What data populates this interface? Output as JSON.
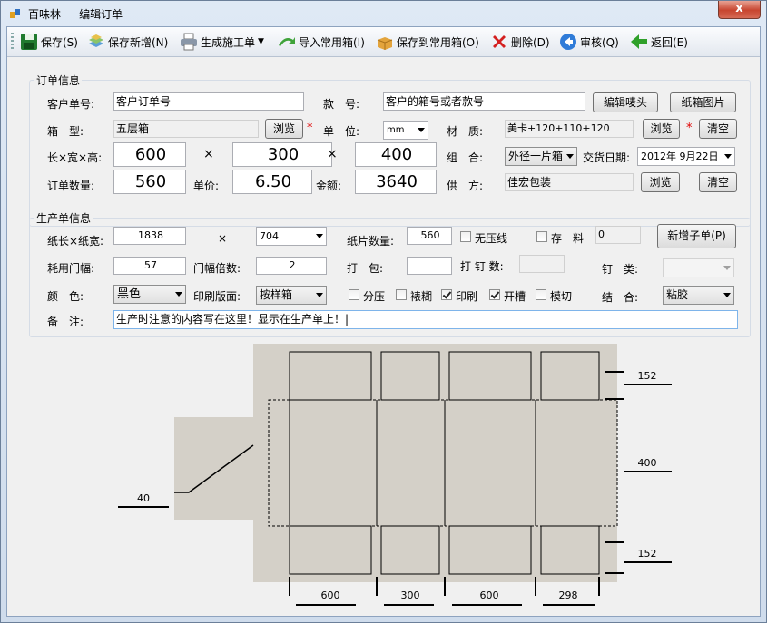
{
  "window": {
    "title": "百味林 - - 编辑订单",
    "close_glyph": "x"
  },
  "toolbar": {
    "save": "保存(S)",
    "save_new": "保存新增(N)",
    "generate_work_order": "生成施工单",
    "import_common_box": "导入常用箱(I)",
    "save_to_common_box": "保存到常用箱(O)",
    "delete": "删除(D)",
    "review": "审核(Q)",
    "back": "返回(E)"
  },
  "order_info": {
    "group_title": "订单信息",
    "customer_order_no_label": "客户单号:",
    "customer_order_no": "客户订单号",
    "style_no_label": "款　号:",
    "style_no": "客户的箱号或者款号",
    "edit_mark_button": "编辑唛头",
    "box_image_button": "纸箱图片",
    "box_type_label": "箱　型:",
    "box_type": "五层箱",
    "browse_label": "浏览",
    "unit_label": "单　位:",
    "unit": "mm",
    "material_label": "材　质:",
    "material": "美卡+120+110+120",
    "clear_label": "清空",
    "lwh_label": "长×宽×高:",
    "length": "600",
    "width": "300",
    "height": "400",
    "times1": "×",
    "times2": "×",
    "combine_label": "组　合:",
    "combine": "外径一片箱",
    "delivery_date_label": "交货日期:",
    "delivery_date": "2012年 9月22日",
    "quantity_label": "订单数量:",
    "quantity": "560",
    "price_label": "单价:",
    "price": "6.50",
    "amount_label": "金额:",
    "amount": "3640",
    "supplier_label": "供　方:",
    "supplier": "佳宏包装",
    "required_mark": "*"
  },
  "production_info": {
    "group_title": "生产单信息",
    "sheet_lw_label": "纸长×纸宽:",
    "sheet_length": "1838",
    "sheet_times": "×",
    "sheet_width": "704",
    "sheet_count_label": "纸片数量:",
    "sheet_count": "560",
    "no_press_line_label": "无压线",
    "stock_label": "存　料",
    "stock_value": "0",
    "add_sub_order_button": "新增子单(P)",
    "material_width_label": "耗用门幅:",
    "material_width": "57",
    "width_multiple_label": "门幅倍数:",
    "width_multiple": "2",
    "pack_label": "打　包:",
    "pack_value": "",
    "staple_count_label": "打 钉 数:",
    "staple_type_label": "钉　类:",
    "color_label": "颜　色:",
    "color": "黑色",
    "print_plate_label": "印刷版面:",
    "print_plate": "按样箱",
    "fenya_label": "分压",
    "biaohu_label": "裱糊",
    "print_label": "印刷",
    "slot_label": "开槽",
    "die_cut_label": "模切",
    "join_label": "结　合:",
    "join": "粘胶",
    "remark_label": "备　注:",
    "remark": "生产时注意的内容写在这里！显示在生产单上！|",
    "checks": {
      "no_press_line": false,
      "stock": false,
      "fenya": false,
      "biaohu": false,
      "print": true,
      "slot": true,
      "die_cut": false
    }
  },
  "diagram": {
    "flap_top": "152",
    "body_height": "400",
    "flap_bottom": "152",
    "glue_flap": "40",
    "panels": [
      "600",
      "300",
      "600",
      "298"
    ]
  },
  "colors": {
    "diagram_bg": "#d4d0c8",
    "accent_red": "#e00000"
  }
}
